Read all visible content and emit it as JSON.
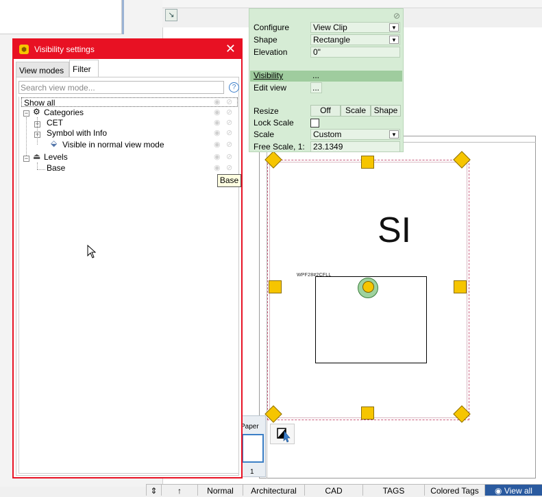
{
  "dialog": {
    "title": "Visibility settings",
    "close_glyph": "✕",
    "tabs": [
      {
        "label": "View modes"
      },
      {
        "label": "Filter"
      }
    ],
    "search_placeholder": "Search view mode...",
    "help_glyph": "?",
    "tree": {
      "show_all": "Show all",
      "categories": "Categories",
      "cet": "CET",
      "symbol_with_info": "Symbol with Info",
      "visible_normal": "Visible in normal view mode",
      "levels": "Levels",
      "base": "Base"
    },
    "tooltip": "Base"
  },
  "properties": {
    "configure_label": "Configure",
    "configure_value": "View Clip",
    "shape_label": "Shape",
    "shape_value": "Rectangle",
    "elevation_label": "Elevation",
    "elevation_value": "0\"",
    "visibility_label": "Visibility",
    "visibility_value": "...",
    "edit_view_label": "Edit view",
    "edit_view_value": "...",
    "resize_label": "Resize",
    "resize_options": [
      "Off",
      "Scale",
      "Shape"
    ],
    "lock_scale_label": "Lock Scale",
    "scale_label": "Scale",
    "scale_value": "Custom",
    "free_scale_label": "Free Scale, 1:",
    "free_scale_value": "23.1349"
  },
  "canvas": {
    "big_text": "SI",
    "small_label": "WPF28#2CFLL",
    "paper_tab_label": "Paper",
    "paper_tab_number": "1"
  },
  "statusbar": {
    "modes": [
      "Normal",
      "Architectural",
      "CAD",
      "TAGS",
      "Colored Tags"
    ],
    "view_all": "View all"
  },
  "icons": {
    "expand": "⊞",
    "collapse": "⊟",
    "eye": "eye-icon",
    "hidden": "eye-slash-icon"
  },
  "colors": {
    "dialog_border": "#e81123",
    "props_bg": "#d6ecd5",
    "handle": "#f6c500",
    "view_all_bg": "#2a5a9f"
  }
}
